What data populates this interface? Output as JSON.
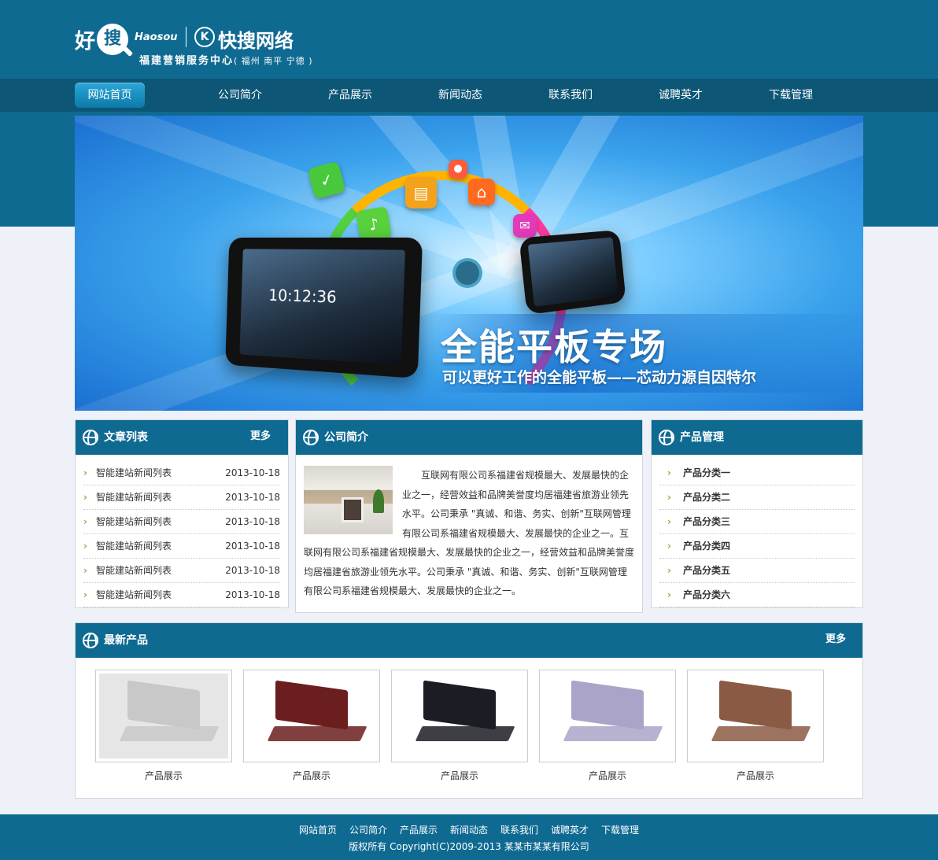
{
  "header": {
    "logo_hao": "好",
    "logo_sou": "搜",
    "logo_en": "Haosou",
    "logo_k": "K",
    "brand": "快搜网络",
    "subtitle": "福建营销服务中心",
    "subtitle_cities": "( 福州  南平  宁德 )"
  },
  "nav": {
    "items": [
      "网站首页",
      "公司简介",
      "产品展示",
      "新闻动态",
      "联系我们",
      "诚聘英才",
      "下载管理"
    ],
    "active_index": 0
  },
  "banner": {
    "title": "全能平板专场",
    "subtitle": "可以更好工作的全能平板——芯动力源自因特尔",
    "clock": "10:12:36"
  },
  "news_panel": {
    "title": "文章列表",
    "more": "更多",
    "items": [
      {
        "title": "智能建站新闻列表",
        "date": "2013-10-18"
      },
      {
        "title": "智能建站新闻列表",
        "date": "2013-10-18"
      },
      {
        "title": "智能建站新闻列表",
        "date": "2013-10-18"
      },
      {
        "title": "智能建站新闻列表",
        "date": "2013-10-18"
      },
      {
        "title": "智能建站新闻列表",
        "date": "2013-10-18"
      },
      {
        "title": "智能建站新闻列表",
        "date": "2013-10-18"
      }
    ]
  },
  "about_panel": {
    "title": "公司简介",
    "text": "互联网有限公司系福建省规模最大、发展最快的企业之一，经营效益和品牌美誉度均居福建省旅游业领先水平。公司秉承 \"真诚、和谐、务实、创新\"互联网管理有限公司系福建省规模最大、发展最快的企业之一。互联网有限公司系福建省规模最大、发展最快的企业之一，经营效益和品牌美誉度均居福建省旅游业领先水平。公司秉承 \"真诚、和谐、务实、创新\"互联网管理有限公司系福建省规模最大、发展最快的企业之一。"
  },
  "product_panel": {
    "title": "产品管理",
    "items": [
      "产品分类一",
      "产品分类二",
      "产品分类三",
      "产品分类四",
      "产品分类五",
      "产品分类六"
    ]
  },
  "latest": {
    "title": "最新产品",
    "more": "更多",
    "items": [
      {
        "caption": "产品展示",
        "color": "#c8c8c8"
      },
      {
        "caption": "产品展示",
        "color": "#6b1e1e"
      },
      {
        "caption": "产品展示",
        "color": "#1c1c24"
      },
      {
        "caption": "产品展示",
        "color": "#a9a4c8"
      },
      {
        "caption": "产品展示",
        "color": "#8a5a44"
      }
    ]
  },
  "footer": {
    "links": [
      "网站首页",
      "公司简介",
      "产品展示",
      "新闻动态",
      "联系我们",
      "诚聘英才",
      "下载管理"
    ],
    "copyright": "版权所有 Copyright(C)2009-2013 某某市某某有限公司"
  },
  "colors": {
    "primary": "#0f6a92",
    "nav_bg": "#0d5676",
    "accent_arrow": "#7ab63a"
  }
}
